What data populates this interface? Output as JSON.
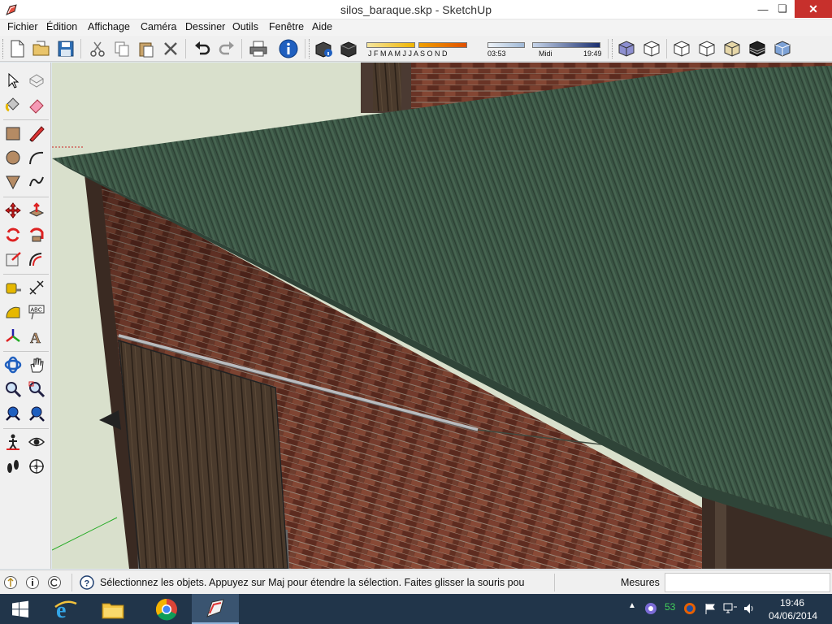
{
  "window": {
    "title": "silos_baraque.skp - SketchUp"
  },
  "menu": [
    "Fichier",
    "Édition",
    "Affichage",
    "Caméra",
    "Dessiner",
    "Outils",
    "Fenêtre",
    "Aide"
  ],
  "toolbar": {
    "buttons": [
      "new-file",
      "open-folder",
      "save",
      "cut",
      "copy",
      "paste",
      "erase",
      "undo",
      "redo",
      "print",
      "model-info"
    ],
    "shadow_months": "J F M A M J J A S O N D",
    "shadow_date_label": "03:53",
    "shadow_time_mid": "Midi",
    "shadow_time_end": "19:49",
    "views": [
      "iso",
      "top",
      "front",
      "right",
      "back",
      "left"
    ]
  },
  "status": {
    "text": "Sélectionnez les objets. Appuyez sur Maj pour étendre la sélection. Faites glisser la souris pou",
    "measures_label": "Mesures",
    "measures_value": ""
  },
  "taskbar": {
    "tray_number": "53",
    "time": "19:46",
    "date": "04/06/2014"
  },
  "colors": {
    "roof": "#3f5a48",
    "brick": "#6e3526",
    "door": "#4a3a2c",
    "sky": "#d9e0cc",
    "taskbar": "#21354a",
    "close": "#c7302c"
  }
}
